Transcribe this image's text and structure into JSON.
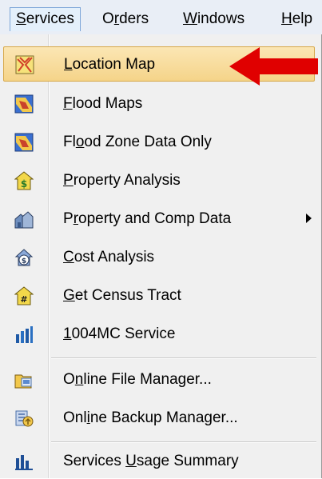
{
  "menubar": {
    "items": [
      {
        "label_pre": "",
        "label_u": "S",
        "label_post": "ervices"
      },
      {
        "label_pre": "O",
        "label_u": "r",
        "label_post": "ders"
      },
      {
        "label_pre": "",
        "label_u": "W",
        "label_post": "indows"
      },
      {
        "label_pre": "",
        "label_u": "H",
        "label_post": "elp"
      }
    ]
  },
  "menu": {
    "items": [
      {
        "pre": "",
        "u": "L",
        "post": "ocation Map",
        "icon": "location-map-icon"
      },
      {
        "pre": "",
        "u": "F",
        "post": "lood Maps",
        "icon": "flood-map-icon"
      },
      {
        "pre": "Fl",
        "u": "o",
        "post": "od Zone Data Only",
        "icon": "flood-zone-icon"
      },
      {
        "pre": "",
        "u": "P",
        "post": "roperty Analysis",
        "icon": "property-analysis-icon"
      },
      {
        "pre": "P",
        "u": "r",
        "post": "operty and Comp Data",
        "icon": "property-comp-icon"
      },
      {
        "pre": "",
        "u": "C",
        "post": "ost Analysis",
        "icon": "cost-analysis-icon"
      },
      {
        "pre": "",
        "u": "G",
        "post": "et Census Tract",
        "icon": "census-tract-icon"
      },
      {
        "pre": "",
        "u": "1",
        "post": "004MC Service",
        "icon": "bar-chart-icon"
      },
      {
        "pre": "O",
        "u": "n",
        "post": "line File Manager...",
        "icon": "file-manager-icon"
      },
      {
        "pre": "Onl",
        "u": "i",
        "post": "ne Backup Manager...",
        "icon": "backup-manager-icon"
      },
      {
        "pre": "Services ",
        "u": "U",
        "post": "sage Summary",
        "icon": "usage-summary-icon"
      }
    ]
  },
  "colors": {
    "highlight": "#f7d995",
    "arrow": "#e00000"
  }
}
